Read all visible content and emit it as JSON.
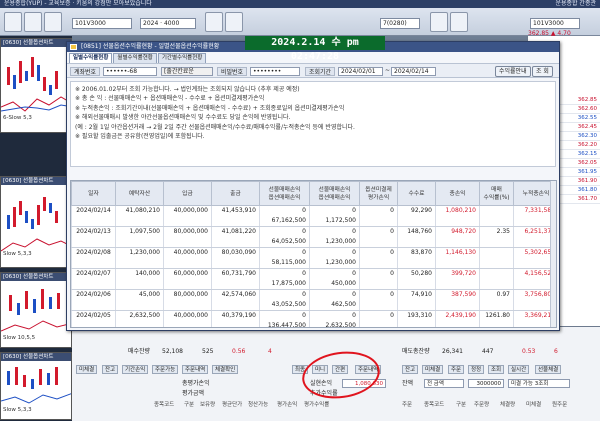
{
  "top_menu": {
    "left": "운용종합(YUP) - 교육보증 · 키움의 강점만 모아보았습니다",
    "right": "운용종합  간종관"
  },
  "toolbar": {
    "combo1": "101V3000",
    "combo2": "2024 · 4000",
    "combo3": "7(0280)",
    "combo4": "101V3000",
    "price1": "362.85 ▲ 4.70"
  },
  "timestamp": "2024.2.14 수 pm 02:47:28",
  "dialog": {
    "title": "[0851] 선물옵션수익률현황 - 일별선물옵션수익률현황",
    "tabs": [
      "일별수익률현황",
      "월별수익률현황",
      "기간별수익률현황"
    ],
    "form": {
      "account_label": "계좌번호",
      "account_value": "••••••-68",
      "account_name": "[출간칸료운",
      "password_label": "비밀번호",
      "password_value": "••••••••",
      "period_label": "조회기간",
      "date_from": "2024/02/01",
      "date_to": "2024/02/14",
      "guide_button": "수익률안내",
      "query_button": "조 회"
    },
    "notes": [
      "※ 2006.01.02부터 조회 가능합니다. → 법인계좌는 조회되지 않습니다 (추후 제공 예정)",
      "※ 총  손  익 : 선물매매손익 + 옵션매매손익 - 수수료 + 옵션미결제평가손익",
      "※ 누적총손익 : 조회기간이내(선물매매손익 + 옵션매매손익 - 수수료) + 조회종료일의 옵션미결제평가손익",
      "※ 해외선물매매시 발생한 야간선물옵션매매손익 및 수수료도 당일 손익에 반영됩니다.",
      "   (예 : 2월 1일 야간옵션거래 → 2월 2일 주간 선물옵션매매손익/수수료/매매수익률/누적총손익 등에 반영합니다.",
      "※ 필요할 입출금은 공유함(전영업일)에 포함됩니다."
    ],
    "columns": [
      "일자",
      "예탁자산",
      "입금",
      "출금",
      "선물매매손익\n옵션매매손익",
      "선물매매손익\n옵션매매손익",
      "옵션미결제\n평가손익",
      "수수료",
      "총손익",
      "매매\n수익률(%)",
      "누적총손익"
    ],
    "rows": [
      {
        "date": "2024/02/14",
        "asset": "41,080,210",
        "deposit": "40,000,000",
        "withdraw": "41,453,910",
        "pl1a": "0",
        "pl1b": "67,162,500",
        "pl2a": "0",
        "pl2b": "1,172,500",
        "eval": "0",
        "fee": "92,290",
        "total": "1,080,210",
        "ratio": "",
        "cum": "7,331,580"
      },
      {
        "date": "2024/02/13",
        "asset": "1,097,500",
        "deposit": "80,000,000",
        "withdraw": "41,081,220",
        "pl1a": "0",
        "pl1b": "64,052,500",
        "pl2a": "0",
        "pl2b": "1,230,000",
        "eval": "0",
        "fee": "148,760",
        "total": "948,720",
        "ratio": "2.35",
        "cum": "6,251,370"
      },
      {
        "date": "2024/02/08",
        "asset": "1,230,000",
        "deposit": "40,000,000",
        "withdraw": "80,030,090",
        "pl1a": "0",
        "pl1b": "58,115,000",
        "pl2a": "0",
        "pl2b": "1,230,000",
        "eval": "0",
        "fee": "83,870",
        "total": "1,146,130",
        "ratio": "",
        "cum": "5,302,650"
      },
      {
        "date": "2024/02/07",
        "asset": "140,000",
        "deposit": "60,000,000",
        "withdraw": "60,731,790",
        "pl1a": "0",
        "pl1b": "17,875,000",
        "pl2a": "0",
        "pl2b": "450,000",
        "eval": "0",
        "fee": "50,280",
        "total": "399,720",
        "ratio": "",
        "cum": "4,156,520"
      },
      {
        "date": "2024/02/06",
        "asset": "45,000",
        "deposit": "80,000,000",
        "withdraw": "42,574,060",
        "pl1a": "0",
        "pl1b": "43,052,500",
        "pl2a": "0",
        "pl2b": "462,500",
        "eval": "0",
        "fee": "74,910",
        "total": "387,590",
        "ratio": "0.97",
        "cum": "3,756,800"
      },
      {
        "date": "2024/02/05",
        "asset": "2,632,500",
        "deposit": "40,000,000",
        "withdraw": "40,379,190",
        "pl1a": "0",
        "pl1b": "136,447,500",
        "pl2a": "0",
        "pl2b": "2,632,500",
        "eval": "0",
        "fee": "193,310",
        "total": "2,439,190",
        "ratio": "1261.80",
        "cum": "3,369,210"
      },
      {
        "date": "2024/02/02",
        "asset": "572,500",
        "deposit": "40,000,000",
        "withdraw": "40,551,410",
        "pl1a": "0",
        "pl1b": "67,590,000",
        "pl2a": "0",
        "pl2b": "467,500",
        "eval": "0",
        "fee": "128,590",
        "total": "338,910",
        "ratio": "145.09",
        "cum": "930,020"
      }
    ]
  },
  "left_charts": [
    {
      "head": "[0630] 선물옵션차트",
      "label": "6-Slow 5,3"
    },
    {
      "head": "[0630] 선물옵션차트",
      "label": "Slow 5,3,3"
    },
    {
      "head": "[0630] 선물옵션차트",
      "label": "Slow 10,5,5"
    },
    {
      "head": "[0630] 선물옵션차트",
      "label": "Slow 5,3,3"
    }
  ],
  "right_values": [
    {
      "v": "362.85",
      "c": "red"
    },
    {
      "v": "362.60",
      "c": "red"
    },
    {
      "v": "362.55",
      "c": "blue"
    },
    {
      "v": "362.45",
      "c": "red"
    },
    {
      "v": "362.30",
      "c": "blue"
    },
    {
      "v": "362.20",
      "c": "red"
    },
    {
      "v": "362.15",
      "c": "blue"
    },
    {
      "v": "362.05",
      "c": "red"
    },
    {
      "v": "361.95",
      "c": "blue"
    },
    {
      "v": "361.90",
      "c": "red"
    },
    {
      "v": "361.80",
      "c": "blue"
    },
    {
      "v": "361.70",
      "c": "red"
    }
  ],
  "bottom": {
    "row1": {
      "label1": "매수잔량",
      "val1": "52,108",
      "val2": "525",
      "pct1": "0.56",
      "pct2": "4",
      "sell_total": "매도총잔량",
      "sell_val": "26,341",
      "sell_num": "447",
      "pct3": "0.53",
      "pct4": "6"
    },
    "tabs": [
      "미체결",
      "잔고",
      "기간손익",
      "주문가능",
      "주문내역",
      "체결확인",
      "최종",
      "미니",
      "간편",
      "주문내역"
    ],
    "eval_label": "총평가손익",
    "realized_label": "실현손익",
    "realized_value": "1,080,630",
    "eval_rate_label": "평가금액",
    "quick_label": "추가수익률",
    "sub_labels": [
      "종목코드",
      "구분",
      "보유량",
      "평균단가",
      "청산가능",
      "평가손익",
      "평가수익률"
    ],
    "right_tabs": [
      "잔고",
      "미체결",
      "주문",
      "정정",
      "조회",
      "실시간",
      "선물체결"
    ],
    "right_fields": [
      "잔액",
      "전 금액",
      "3000000",
      "미결 가능 3조회"
    ],
    "right_cols": [
      "주문",
      "종목코드",
      "구분",
      "주문량",
      "체결량",
      "미체결",
      "원주문"
    ]
  }
}
